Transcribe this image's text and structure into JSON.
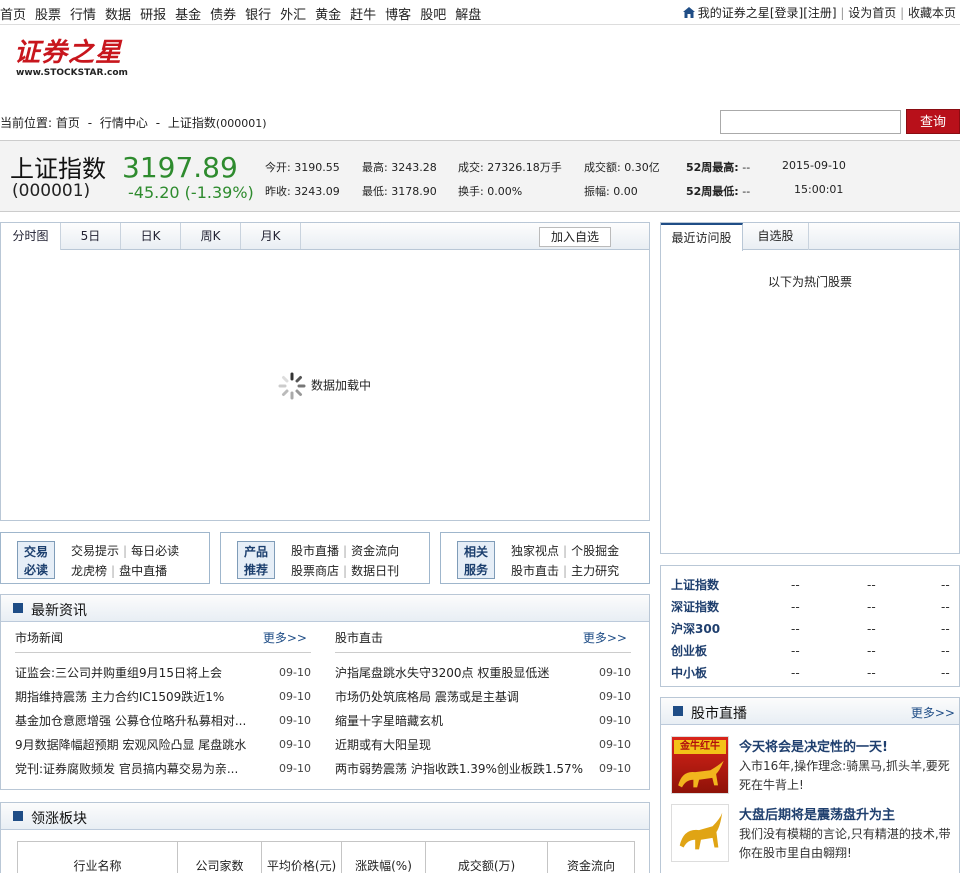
{
  "topnav": {
    "items": [
      "首页",
      "股票",
      "行情",
      "数据",
      "研报",
      "基金",
      "债券",
      "银行",
      "外汇",
      "黄金",
      "赶牛",
      "博客",
      "股吧",
      "解盘"
    ],
    "right": {
      "home": "我的证券之星",
      "login": "[登录]",
      "register": "[注册]",
      "set_home": "设为首页",
      "bookmark": "收藏本页",
      "sep": "|"
    }
  },
  "logo": {
    "cn": "证券之星",
    "en": "www.STOCKSTAR.com"
  },
  "breadcrumb": {
    "label": "当前位置:",
    "home": "首页",
    "sep": "-",
    "market": "行情中心",
    "current": "上证指数",
    "code": "(000001)"
  },
  "search": {
    "placeholder": "",
    "button": "查询"
  },
  "quote": {
    "name": "上证指数",
    "code": "(000001)",
    "price": "3197.89",
    "change": "-45.20",
    "change_pct": "(-1.39%)",
    "open_label": "今开:",
    "open": "3190.55",
    "high_label": "最高:",
    "high": "3243.28",
    "volume_label": "成交:",
    "volume": "27326.18万手",
    "amount_label": "成交额:",
    "amount": "0.30亿",
    "w52_high_label": "52周最高:",
    "w52_high": "--",
    "date": "2015-09-10",
    "prev_close_label": "昨收:",
    "prev_close": "3243.09",
    "low_label": "最低:",
    "low": "3178.90",
    "turnover_label": "换手:",
    "turnover": "0.00%",
    "amplitude_label": "振幅:",
    "amplitude": "0.00",
    "w52_low_label": "52周最低:",
    "w52_low": "--",
    "time": "15:00:01"
  },
  "chart": {
    "tabs": [
      "分时图",
      "5日",
      "日K",
      "周K",
      "月K"
    ],
    "add_watchlist": "加入自选",
    "loading": "数据加载中"
  },
  "blocks": [
    {
      "label1": "交易",
      "label2": "必读",
      "links": [
        "交易提示",
        "每日必读",
        "龙虎榜",
        "盘中直播"
      ]
    },
    {
      "label1": "产品",
      "label2": "推荐",
      "links": [
        "股市直播",
        "资金流向",
        "股票商店",
        "数据日刊"
      ]
    },
    {
      "label1": "相关",
      "label2": "服务",
      "links": [
        "独家视点",
        "个股掘金",
        "股市直击",
        "主力研究"
      ]
    }
  ],
  "news": {
    "title": "最新资讯",
    "more": "更多>>",
    "left": {
      "heading": "市场新闻",
      "rows": [
        {
          "t": "证监会:三公司并购重组9月15日将上会",
          "d": "09-10"
        },
        {
          "t": "期指维持震荡 主力合约IC1509跌近1%",
          "d": "09-10"
        },
        {
          "t": "基金加仓意愿增强 公募仓位略升私募相对...",
          "d": "09-10"
        },
        {
          "t": "9月数据降幅超预期 宏观风险凸显 尾盘跳水",
          "d": "09-10"
        },
        {
          "t": "党刊:证券腐败频发 官员搞内幕交易为亲...",
          "d": "09-10"
        }
      ]
    },
    "right": {
      "heading": "股市直击",
      "rows": [
        {
          "t": "沪指尾盘跳水失守3200点 权重股显低迷",
          "d": "09-10"
        },
        {
          "t": "市场仍处筑底格局 震荡或是主基调",
          "d": "09-10"
        },
        {
          "t": "缩量十字星暗藏玄机",
          "d": "09-10"
        },
        {
          "t": "近期或有大阳呈现",
          "d": "09-10"
        },
        {
          "t": "两市弱势震荡 沪指收跌1.39%创业板跌1.57%",
          "d": "09-10"
        }
      ]
    }
  },
  "sector": {
    "title": "领涨板块",
    "headers": [
      "行业名称",
      "公司家数",
      "平均价格(元)",
      "涨跌幅(%)",
      "成交额(万)",
      "资金流向"
    ]
  },
  "right_panel": {
    "tabs": [
      "最近访问股",
      "自选股"
    ],
    "hot_label": "以下为热门股票"
  },
  "indices": [
    {
      "name": "上证指数",
      "a": "--",
      "b": "--",
      "c": "--"
    },
    {
      "name": "深证指数",
      "a": "--",
      "b": "--",
      "c": "--"
    },
    {
      "name": "沪深300",
      "a": "--",
      "b": "--",
      "c": "--"
    },
    {
      "name": "创业板",
      "a": "--",
      "b": "--",
      "c": "--"
    },
    {
      "name": "中小板",
      "a": "--",
      "b": "--",
      "c": "--"
    }
  ],
  "live": {
    "title": "股市直播",
    "more": "更多>>",
    "items": [
      {
        "title": "今天将会是决定性的一天!",
        "desc": "入市16年,操作理念:骑黑马,抓头羊,要死死在牛背上!",
        "thumb_text": "金牛红牛"
      },
      {
        "title": "大盘后期将是震荡盘升为主",
        "desc": "我们没有模糊的言论,只有精湛的技术,带你在股市里自由翱翔!",
        "thumb_text": ""
      }
    ]
  },
  "colors": {
    "accent": "#b8101a",
    "down": "#2e8b2e",
    "navy": "#1f4d86",
    "border": "#b9c7d6"
  }
}
